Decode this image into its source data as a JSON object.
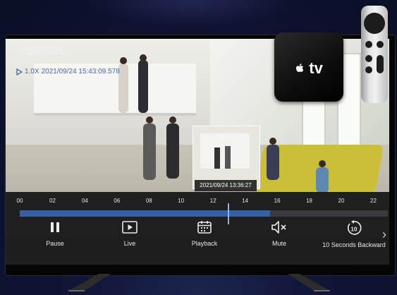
{
  "camera": {
    "title": "Camera 015"
  },
  "playback": {
    "speed": "1.0X",
    "timestamp": "2021/09/24 15:43:09.578"
  },
  "preview": {
    "timestamp": "2021/09/24 13:36:27"
  },
  "timeline": {
    "ticks": [
      "00",
      "02",
      "04",
      "06",
      "08",
      "10",
      "12",
      "14",
      "16",
      "18",
      "20",
      "22"
    ],
    "progress_fraction": 0.68
  },
  "controls": [
    {
      "label": "Pause",
      "icon": "pause-icon"
    },
    {
      "label": "Live",
      "icon": "live-icon"
    },
    {
      "label": "Playback",
      "icon": "calendar-icon"
    },
    {
      "label": "Mute",
      "icon": "mute-icon"
    },
    {
      "label": "10 Seconds Backward",
      "icon": "rewind-10-icon"
    }
  ],
  "more_icon": "chevron-right-icon",
  "apple_tv": {
    "logo_text": "tv"
  },
  "colors": {
    "accent": "#3560a6",
    "bar_bg": "#121214"
  }
}
